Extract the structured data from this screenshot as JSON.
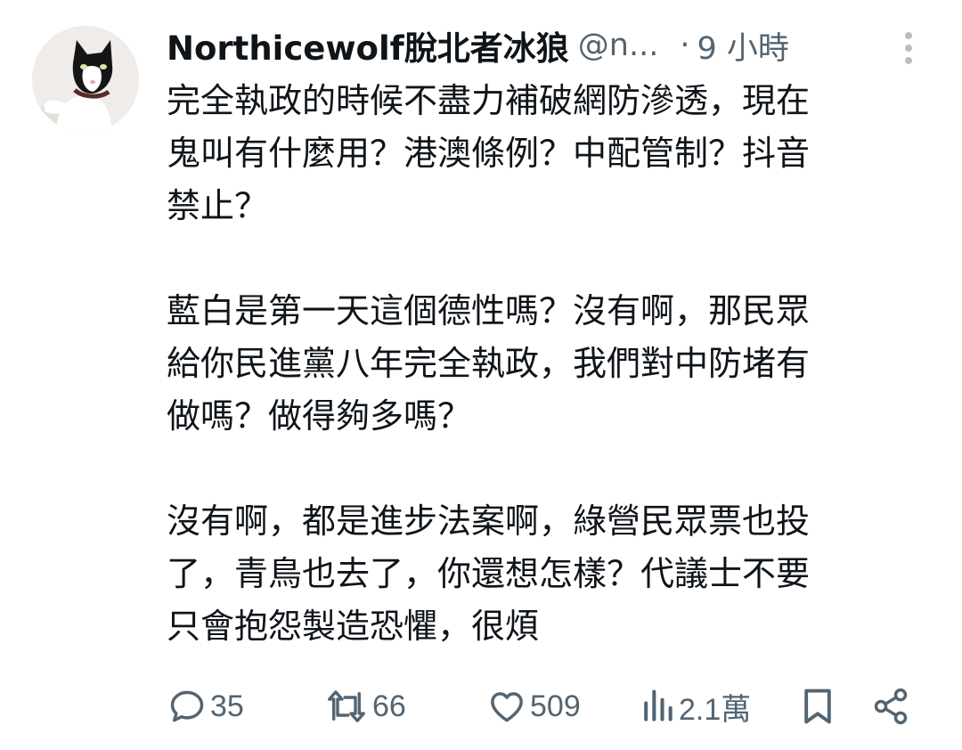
{
  "tweet": {
    "author_name": "Northicewolf脫北者冰狼",
    "handle": "@n...",
    "separator": "·",
    "time": "9 小時",
    "avatar_icon": "cat-avatar-icon",
    "paragraphs": [
      [
        "完全執政的時候不盡力補破網防滲透，現在",
        "鬼叫有什麼用？港澳條例？中配管制？抖音",
        "禁止？"
      ],
      [
        "藍白是第一天這個德性嗎？沒有啊，那民眾",
        "給你民進黨八年完全執政，我們對中防堵有",
        "做嗎？做得夠多嗎？"
      ],
      [
        "沒有啊，都是進步法案啊，綠營民眾票也投",
        "了，青鳥也去了，你還想怎樣？代議士不要",
        "只會抱怨製造恐懼，很煩"
      ]
    ]
  },
  "actions": {
    "reply_count": "35",
    "retweet_count": "66",
    "like_count": "509",
    "views_count": "2.1萬",
    "icons": [
      "reply-icon",
      "retweet-icon",
      "like-icon",
      "views-icon",
      "bookmark-icon",
      "share-icon"
    ]
  },
  "colors": {
    "text": "#0f1419",
    "secondary": "#536471",
    "background": "#ffffff"
  }
}
